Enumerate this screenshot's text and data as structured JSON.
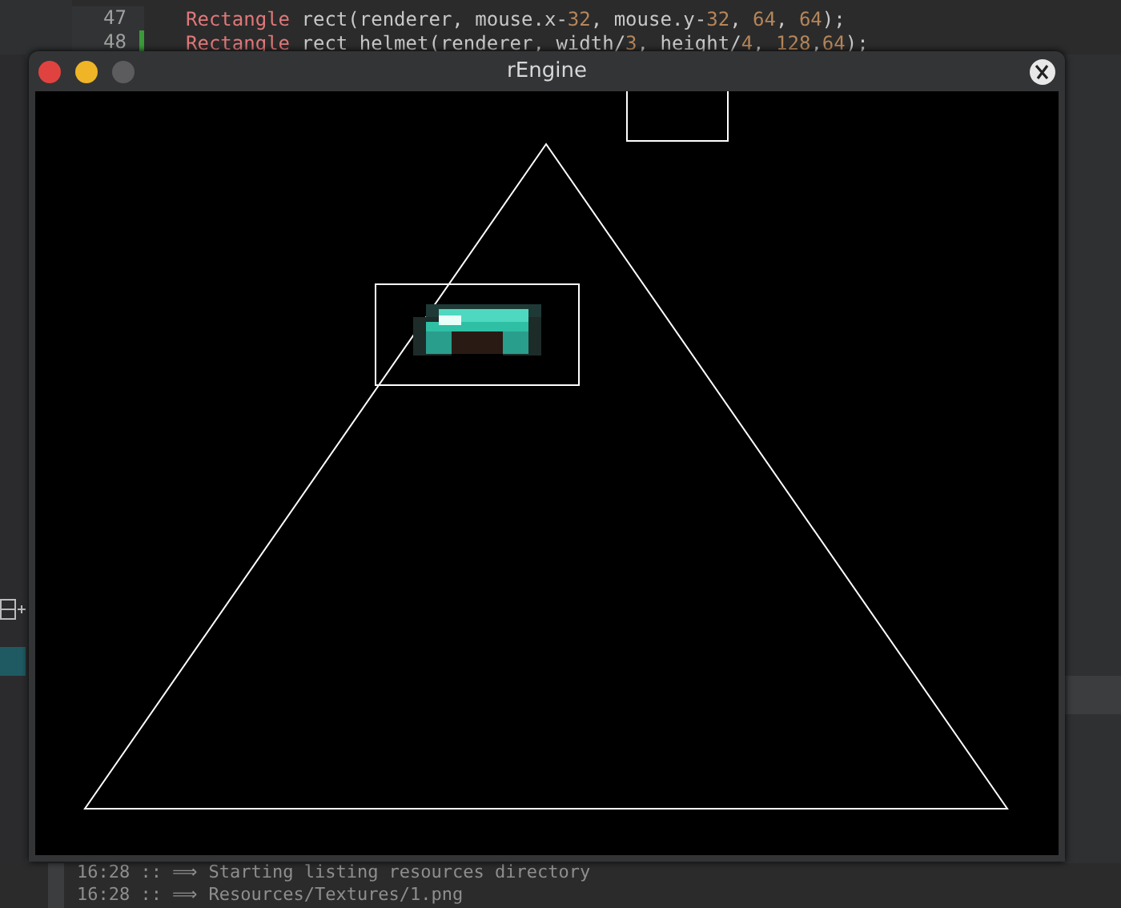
{
  "editor": {
    "lines": [
      {
        "number": "47",
        "modified": false,
        "tokens": [
          {
            "kind": "type",
            "text": "Rectangle"
          },
          {
            "kind": "plain",
            "text": " rect(renderer, mouse.x-"
          },
          {
            "kind": "number",
            "text": "32"
          },
          {
            "kind": "plain",
            "text": ", mouse.y-"
          },
          {
            "kind": "number",
            "text": "32"
          },
          {
            "kind": "plain",
            "text": ", "
          },
          {
            "kind": "number",
            "text": "64"
          },
          {
            "kind": "plain",
            "text": ", "
          },
          {
            "kind": "number",
            "text": "64"
          },
          {
            "kind": "plain",
            "text": ");"
          }
        ]
      },
      {
        "number": "48",
        "modified": true,
        "tokens": [
          {
            "kind": "type",
            "text": "Rectangle"
          },
          {
            "kind": "plain",
            "text": " rect_helmet(renderer, width/"
          },
          {
            "kind": "number",
            "text": "3"
          },
          {
            "kind": "plain",
            "text": ", height/"
          },
          {
            "kind": "number",
            "text": "4"
          },
          {
            "kind": "plain",
            "text": ", "
          },
          {
            "kind": "number",
            "text": "128"
          },
          {
            "kind": "plain",
            "text": ","
          },
          {
            "kind": "number",
            "text": "64"
          },
          {
            "kind": "plain",
            "text": ");"
          }
        ]
      }
    ]
  },
  "window": {
    "title": "rEngine"
  },
  "log": {
    "lines": [
      "16:28 :: ⟹ Starting listing resources directory",
      "16:28 :: ⟹ Resources/Textures/1.png"
    ]
  }
}
